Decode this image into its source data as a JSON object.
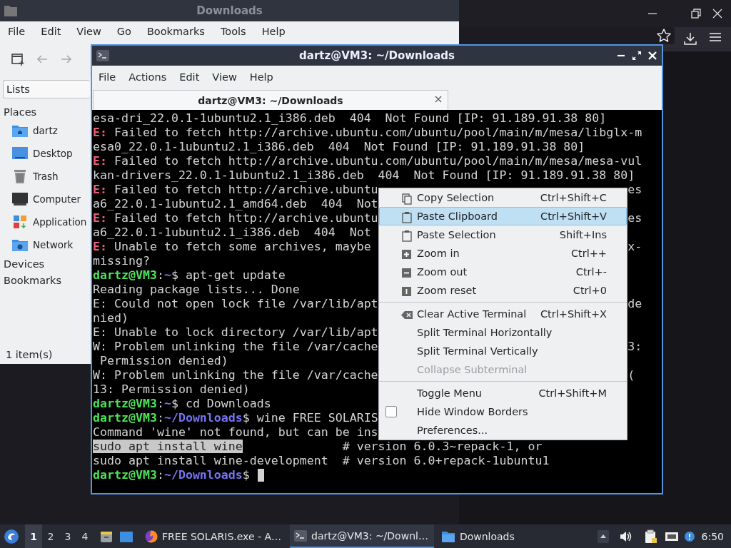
{
  "file_manager": {
    "title": "Downloads",
    "menu": [
      "File",
      "Edit",
      "View",
      "Go",
      "Bookmarks",
      "Tools",
      "Help"
    ],
    "sidebar_selector": "Lists",
    "sidebar": [
      {
        "heading": "Places",
        "items": [
          {
            "label": "dartz"
          },
          {
            "label": "Desktop"
          },
          {
            "label": "Trash"
          },
          {
            "label": "Computer"
          },
          {
            "label": "Application"
          },
          {
            "label": "Network"
          }
        ]
      },
      {
        "heading": "Devices"
      },
      {
        "heading": "Bookmarks"
      }
    ],
    "status_bar": "1 item(s)"
  },
  "terminal": {
    "title": "dartz@VM3: ~/Downloads",
    "menu": [
      "File",
      "Actions",
      "Edit",
      "View",
      "Help"
    ],
    "tabs": [
      {
        "label": "dartz@VM3: ~/Downloads",
        "selected": true
      }
    ],
    "lines": [
      {
        "segments": [
          {
            "text": "esa-dri_22.0.1-1ubuntu2.1_i386.deb  404  Not Found [IP: 91.189.91.38 80]",
            "kind": "plain"
          }
        ]
      },
      {
        "segments": [
          {
            "text": "E:",
            "kind": "error"
          },
          {
            "text": " Failed to fetch http://archive.ubuntu.com/ubuntu/pool/main/m/mesa/libglx-m",
            "kind": "plain"
          }
        ]
      },
      {
        "segments": [
          {
            "text": "esa0_22.0.1-1ubuntu2.1_i386.deb  404  Not Found [IP: 91.189.91.38 80]",
            "kind": "plain"
          }
        ]
      },
      {
        "segments": [
          {
            "text": "E:",
            "kind": "error"
          },
          {
            "text": " Failed to fetch http://archive.ubuntu.com/ubuntu/pool/main/m/mesa/mesa-vul",
            "kind": "plain"
          }
        ]
      },
      {
        "segments": [
          {
            "text": "kan-drivers_22.0.1-1ubuntu2.1_i386.deb  404  Not Found [IP: 91.189.91.38 80]",
            "kind": "plain"
          }
        ]
      },
      {
        "segments": [
          {
            "text": "E:",
            "kind": "error"
          },
          {
            "text": " Failed to fetch http://archive.ubuntu",
            "kind": "plain"
          }
        ],
        "tail": "es"
      },
      {
        "segments": [
          {
            "text": "a6_22.0.1-1ubuntu2.1_amd64.deb  404  Not",
            "kind": "plain"
          }
        ]
      },
      {
        "segments": [
          {
            "text": "E:",
            "kind": "error"
          },
          {
            "text": " Failed to fetch http://archive.ubuntu",
            "kind": "plain"
          }
        ],
        "tail": "es"
      },
      {
        "segments": [
          {
            "text": "a6_22.0.1-1ubuntu2.1_i386.deb  404  Not",
            "kind": "plain"
          }
        ]
      },
      {
        "segments": [
          {
            "text": "E:",
            "kind": "error"
          },
          {
            "text": " Unable to fetch some archives, maybe",
            "kind": "plain"
          }
        ],
        "tail": "x-"
      },
      {
        "segments": [
          {
            "text": "missing?",
            "kind": "plain"
          }
        ]
      },
      {
        "segments": [
          {
            "text": "dartz@VM3",
            "kind": "user"
          },
          {
            "text": ":",
            "kind": "plain"
          },
          {
            "text": "~",
            "kind": "path"
          },
          {
            "text": "$ apt-get update",
            "kind": "plain"
          }
        ]
      },
      {
        "segments": [
          {
            "text": "Reading package lists... Done",
            "kind": "plain"
          }
        ]
      },
      {
        "segments": [
          {
            "text": "E: Could not open lock file /var/lib/apt",
            "kind": "plain"
          }
        ],
        "tail": "de"
      },
      {
        "segments": [
          {
            "text": "nied)",
            "kind": "plain"
          }
        ]
      },
      {
        "segments": [
          {
            "text": "E: Unable to lock directory /var/lib/apt",
            "kind": "plain"
          }
        ]
      },
      {
        "segments": [
          {
            "text": "W: Problem unlinking the file /var/cache",
            "kind": "plain"
          }
        ],
        "tail": "3:"
      },
      {
        "segments": [
          {
            "text": " Permission denied)",
            "kind": "plain"
          }
        ]
      },
      {
        "segments": [
          {
            "text": "W: Problem unlinking the file /var/cache",
            "kind": "plain"
          }
        ],
        "tail": "("
      },
      {
        "segments": [
          {
            "text": "13: Permission denied)",
            "kind": "plain"
          }
        ]
      },
      {
        "segments": [
          {
            "text": "dartz@VM3",
            "kind": "user"
          },
          {
            "text": ":",
            "kind": "plain"
          },
          {
            "text": "~",
            "kind": "path"
          },
          {
            "text": "$ cd Downloads",
            "kind": "plain"
          }
        ]
      },
      {
        "segments": [
          {
            "text": "dartz@VM3",
            "kind": "user"
          },
          {
            "text": ":",
            "kind": "plain"
          },
          {
            "text": "~/Downloads",
            "kind": "path"
          },
          {
            "text": "$ wine FREE SOLARIS",
            "kind": "plain"
          }
        ]
      },
      {
        "segments": [
          {
            "text": "Command 'wine' not found, but can be ins",
            "kind": "plain"
          }
        ]
      },
      {
        "segments": [
          {
            "text": "sudo apt install wine",
            "kind": "selected"
          },
          {
            "text": "              # version 6.0.3~repack-1, or",
            "kind": "plain"
          }
        ]
      },
      {
        "segments": [
          {
            "text": "sudo apt install wine-development  # version 6.0+repack-1ubuntu1",
            "kind": "plain"
          }
        ]
      },
      {
        "segments": [
          {
            "text": "dartz@VM3",
            "kind": "user"
          },
          {
            "text": ":",
            "kind": "plain"
          },
          {
            "text": "~/Downloads",
            "kind": "path"
          },
          {
            "text": "$ ",
            "kind": "plain"
          }
        ],
        "cursor": true
      }
    ]
  },
  "context_menu": {
    "items": [
      {
        "kind": "item",
        "label": "Copy Selection",
        "shortcut": "Ctrl+Shift+C",
        "selected": false,
        "disabled": false
      },
      {
        "kind": "item",
        "label": "Paste Clipboard",
        "shortcut": "Ctrl+Shift+V",
        "selected": true,
        "disabled": false
      },
      {
        "kind": "item",
        "label": "Paste Selection",
        "shortcut": "Shift+Ins",
        "selected": false,
        "disabled": false
      },
      {
        "kind": "item",
        "label": "Zoom in",
        "shortcut": "Ctrl++",
        "selected": false,
        "disabled": false
      },
      {
        "kind": "item",
        "label": "Zoom out",
        "shortcut": "Ctrl+-",
        "selected": false,
        "disabled": false
      },
      {
        "kind": "item",
        "label": "Zoom reset",
        "shortcut": "Ctrl+0",
        "selected": false,
        "disabled": false
      },
      {
        "kind": "separator"
      },
      {
        "kind": "item",
        "label": "Clear Active Terminal",
        "shortcut": "Ctrl+Shift+X",
        "selected": false,
        "disabled": false
      },
      {
        "kind": "item",
        "label": "Split Terminal Horizontally",
        "selected": false,
        "disabled": false
      },
      {
        "kind": "item",
        "label": "Split Terminal Vertically",
        "selected": false,
        "disabled": false
      },
      {
        "kind": "item",
        "label": "Collapse Subterminal",
        "selected": false,
        "disabled": true
      },
      {
        "kind": "separator"
      },
      {
        "kind": "item",
        "label": "Toggle Menu",
        "shortcut": "Ctrl+Shift+M",
        "selected": false,
        "disabled": false
      },
      {
        "kind": "check",
        "label": "Hide Window Borders",
        "checked": false,
        "selected": false,
        "disabled": false
      },
      {
        "kind": "item",
        "label": "Preferences...",
        "selected": false,
        "disabled": false
      }
    ]
  },
  "taskbar": {
    "workspaces": [
      {
        "label": "1",
        "selected": true
      },
      {
        "label": "2",
        "selected": false
      },
      {
        "label": "3",
        "selected": false
      },
      {
        "label": "4",
        "selected": false
      }
    ],
    "tasks": [
      {
        "label": "FREE SOLARIS.exe - A…",
        "selected": false
      },
      {
        "label": "dartz@VM3: ~/Downl…",
        "selected": true
      },
      {
        "label": "Downloads",
        "selected": false
      }
    ],
    "clock": "6:50"
  }
}
